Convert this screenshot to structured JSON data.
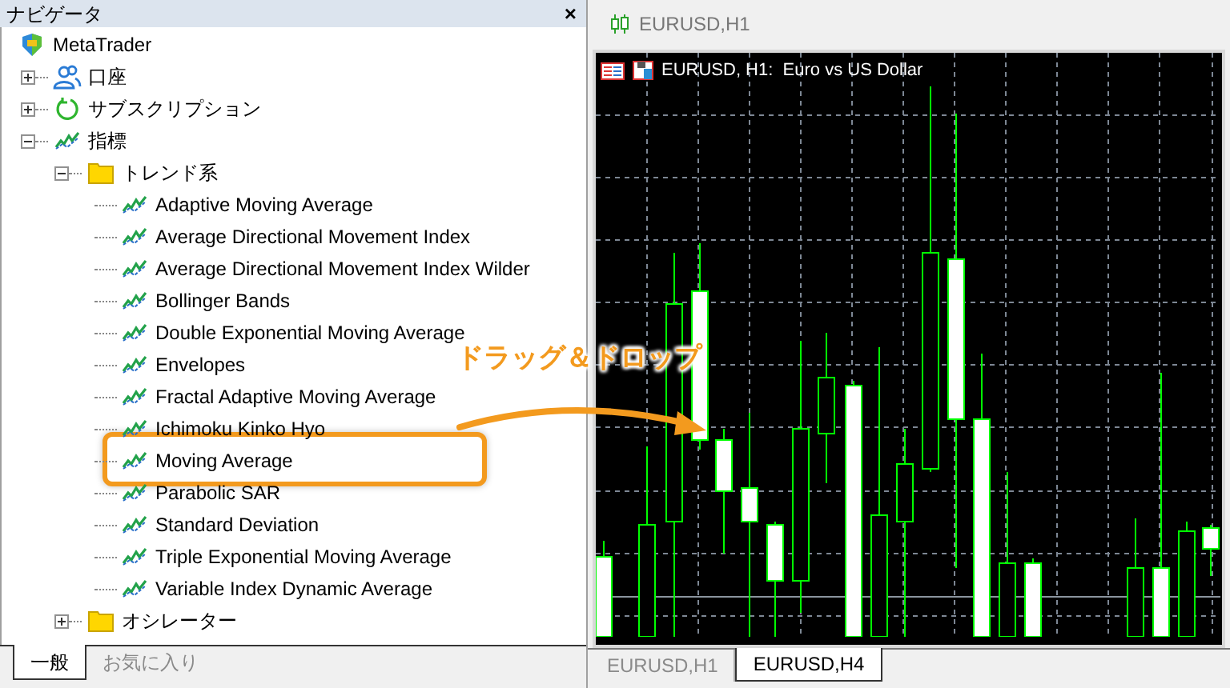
{
  "navigator": {
    "title": "ナビゲータ",
    "close": "×",
    "root": {
      "label": "MetaTrader",
      "kind": "app",
      "children": [
        {
          "label": "口座",
          "kind": "accounts",
          "expanded": false
        },
        {
          "label": "サブスクリプション",
          "kind": "subscription",
          "expanded": false
        },
        {
          "label": "指標",
          "kind": "indicator",
          "expanded": true,
          "children": [
            {
              "label": "トレンド系",
              "kind": "folder",
              "expanded": true,
              "children": [
                {
                  "label": "Adaptive Moving Average",
                  "kind": "indicator",
                  "highlighted": false
                },
                {
                  "label": "Average Directional Movement Index",
                  "kind": "indicator",
                  "highlighted": false
                },
                {
                  "label": "Average Directional Movement Index Wilder",
                  "kind": "indicator",
                  "highlighted": false
                },
                {
                  "label": "Bollinger Bands",
                  "kind": "indicator",
                  "highlighted": false
                },
                {
                  "label": "Double Exponential Moving Average",
                  "kind": "indicator",
                  "highlighted": false
                },
                {
                  "label": "Envelopes",
                  "kind": "indicator",
                  "highlighted": false
                },
                {
                  "label": "Fractal Adaptive Moving Average",
                  "kind": "indicator",
                  "highlighted": false
                },
                {
                  "label": "Ichimoku Kinko Hyo",
                  "kind": "indicator",
                  "highlighted": false
                },
                {
                  "label": "Moving Average",
                  "kind": "indicator",
                  "highlighted": true
                },
                {
                  "label": "Parabolic SAR",
                  "kind": "indicator",
                  "highlighted": false
                },
                {
                  "label": "Standard Deviation",
                  "kind": "indicator",
                  "highlighted": false
                },
                {
                  "label": "Triple Exponential Moving Average",
                  "kind": "indicator",
                  "highlighted": false
                },
                {
                  "label": "Variable Index Dynamic Average",
                  "kind": "indicator",
                  "highlighted": false
                }
              ]
            },
            {
              "label": "オシレーター",
              "kind": "folder",
              "expanded": false
            }
          ]
        }
      ]
    },
    "tabs": [
      {
        "label": "一般",
        "selected": true
      },
      {
        "label": "お気に入り",
        "selected": false
      }
    ]
  },
  "chart_window": {
    "title": "EURUSD,H1",
    "legend": "EURUSD, H1:  Euro vs US Dollar",
    "tabs": [
      {
        "label": "EURUSD,H1",
        "selected": false
      },
      {
        "label": "EURUSD,H4",
        "selected": true
      }
    ]
  },
  "annotation": {
    "label": "ドラッグ＆ドロップ"
  }
}
